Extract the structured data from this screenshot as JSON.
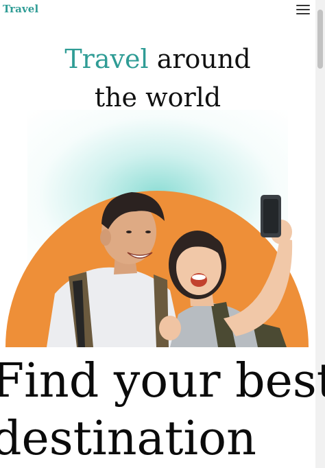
{
  "nav": {
    "brand": "Travel",
    "menu_icon": "hamburger-icon"
  },
  "hero": {
    "title_accent": "Travel",
    "title_rest": " around",
    "title_line2": "the world"
  },
  "image": {
    "description_icon": "couple-selfie-photo"
  },
  "headline": {
    "line1": "Find your best",
    "line2": "destination"
  },
  "colors": {
    "accent": "#2f9c95",
    "sun": "#ee8f38",
    "glow": "#9fe2da"
  }
}
